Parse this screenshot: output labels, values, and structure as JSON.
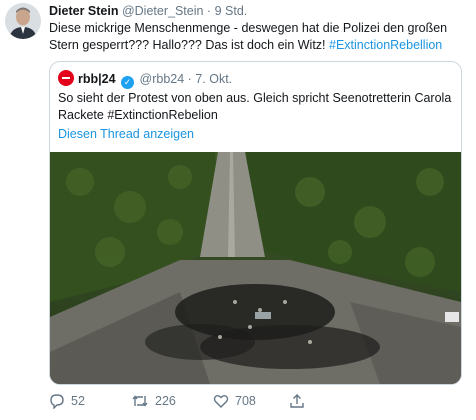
{
  "tweet": {
    "author_name": "Dieter Stein",
    "author_handle": "@Dieter_Stein",
    "time": "9 Std.",
    "text_main": "Diese mickrige Menschenmenge - deswegen hat die Polizei den großen Stern gesperrt??? Hallo??? Das ist doch ein Witz! ",
    "hashtag": "#ExtinctionRebellion"
  },
  "quote": {
    "author_name": "rbb|24",
    "author_handle": "@rbb24",
    "time": "7. Okt.",
    "text": "So sieht der Protest von oben aus. Gleich spricht Seenotretterin Carola Rackete #ExtinctionRebelion",
    "thread_link": "Diesen Thread anzeigen"
  },
  "actions": {
    "replies": "52",
    "retweets": "226",
    "likes": "708"
  },
  "colors": {
    "link": "#1b95e0",
    "muted": "#657786",
    "border": "#ccd6dd",
    "brand_red": "#e2001a"
  },
  "icons": {
    "reply": "reply-icon",
    "retweet": "retweet-icon",
    "like": "heart-icon",
    "share": "share-icon",
    "verified": "verified-badge-icon"
  }
}
